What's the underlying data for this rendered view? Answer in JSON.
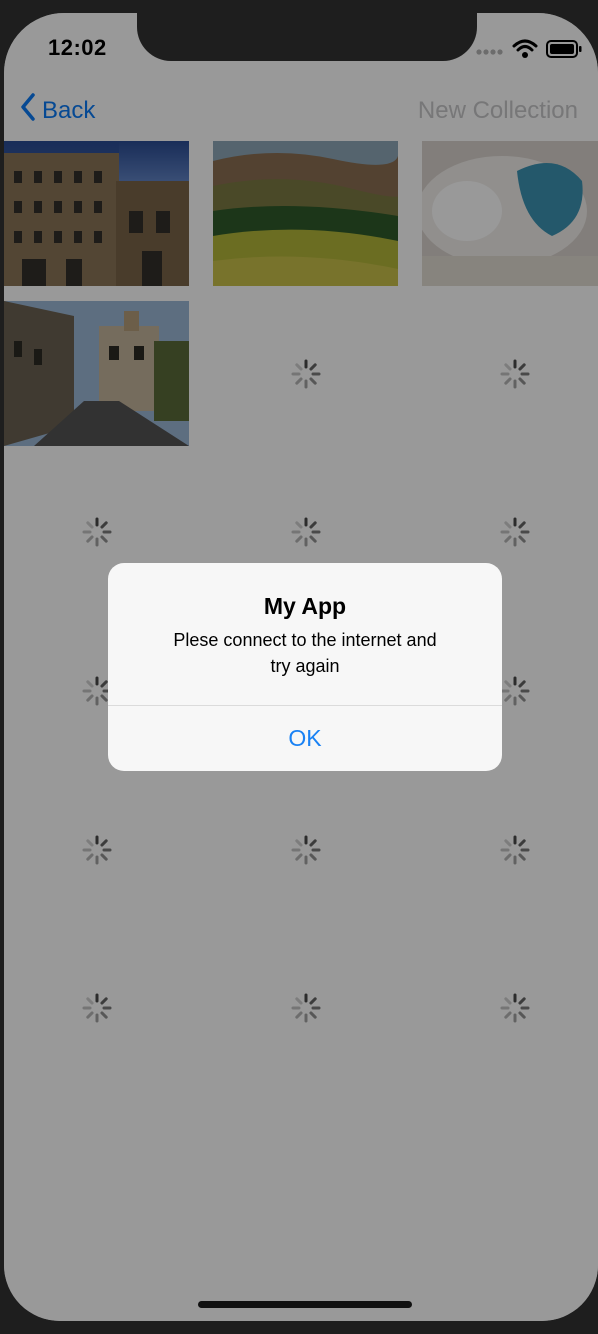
{
  "status_bar": {
    "time": "12:02"
  },
  "nav": {
    "back_label": "Back",
    "action_label": "New Collection"
  },
  "grid": {
    "photos": [
      {
        "name": "building-photo"
      },
      {
        "name": "hills-photo"
      },
      {
        "name": "cat-photo"
      },
      {
        "name": "street-photo"
      }
    ],
    "loading_cells": 14
  },
  "alert": {
    "title": "My App",
    "message_line1": "Plese connect to the internet and",
    "message_line2": "try again",
    "ok_label": "OK"
  },
  "colors": {
    "accent": "#1a82f4",
    "back_blue": "#0a7af5",
    "disabled": "#c6c6c8",
    "dim_overlay": "rgba(0,0,0,0.40)",
    "alert_bg": "#f7f7f7"
  }
}
